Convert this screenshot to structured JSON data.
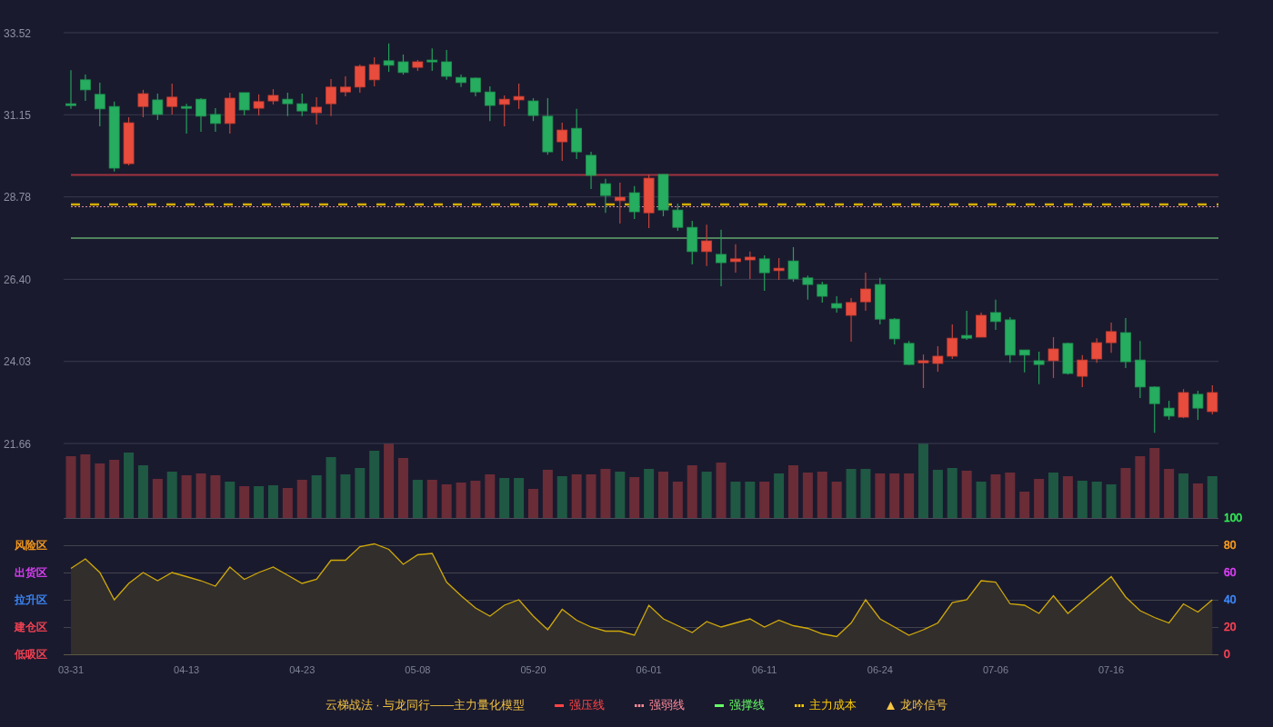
{
  "price_chart": {
    "chart_data": {
      "type": "candlestick",
      "categories": [
        null,
        null,
        null,
        null,
        null,
        null,
        null,
        null,
        null,
        null,
        null,
        null,
        null,
        null,
        null,
        null,
        null,
        null,
        null,
        null,
        null,
        null,
        null,
        null,
        null,
        null,
        null,
        null,
        null,
        null,
        null,
        null,
        null,
        null,
        null,
        null,
        null,
        null,
        null,
        null,
        null,
        null,
        null,
        null,
        null,
        null,
        null,
        null,
        null,
        null,
        null,
        null,
        null,
        null,
        null,
        null,
        null,
        null,
        null,
        null,
        null,
        null,
        null,
        null,
        null,
        null,
        null,
        null,
        null,
        null,
        null,
        null,
        null,
        null,
        null,
        null,
        null,
        null,
        null,
        null
      ],
      "ylim": [
        21.66,
        33.52
      ],
      "yticks": [
        {
          "value": 33.52,
          "label": "33.52"
        },
        {
          "value": 31.15,
          "label": "31.15"
        },
        {
          "value": 28.78,
          "label": "28.78"
        },
        {
          "value": 26.4,
          "label": "26.40"
        },
        {
          "value": 24.03,
          "label": "24.03"
        },
        {
          "value": 21.66,
          "label": "21.66"
        }
      ],
      "grid": true,
      "ohlc": [
        [
          31.47,
          32.44,
          31.32,
          31.42
        ],
        [
          32.16,
          32.31,
          31.55,
          31.87
        ],
        [
          31.74,
          32.08,
          30.82,
          31.32
        ],
        [
          31.39,
          31.53,
          29.51,
          29.61
        ],
        [
          29.74,
          31.08,
          29.69,
          30.92
        ],
        [
          31.39,
          31.87,
          31.08,
          31.76
        ],
        [
          31.58,
          31.76,
          31.0,
          31.16
        ],
        [
          31.39,
          32.05,
          31.16,
          31.66
        ],
        [
          31.39,
          31.47,
          30.61,
          31.34
        ],
        [
          31.6,
          31.63,
          30.66,
          31.11
        ],
        [
          31.16,
          31.34,
          30.66,
          30.9
        ],
        [
          30.9,
          31.79,
          30.61,
          31.63
        ],
        [
          31.79,
          31.79,
          31.13,
          31.29
        ],
        [
          31.34,
          31.74,
          31.13,
          31.53
        ],
        [
          31.55,
          31.89,
          31.45,
          31.71
        ],
        [
          31.6,
          31.79,
          31.11,
          31.47
        ],
        [
          31.47,
          31.76,
          31.11,
          31.26
        ],
        [
          31.21,
          31.66,
          30.87,
          31.37
        ],
        [
          31.47,
          32.18,
          31.11,
          31.95
        ],
        [
          31.81,
          32.26,
          31.68,
          31.95
        ],
        [
          31.95,
          32.6,
          31.79,
          32.55
        ],
        [
          32.16,
          32.81,
          31.97,
          32.6
        ],
        [
          32.71,
          33.21,
          32.39,
          32.58
        ],
        [
          32.68,
          32.89,
          32.31,
          32.37
        ],
        [
          32.52,
          32.73,
          32.42,
          32.68
        ],
        [
          32.73,
          33.07,
          32.42,
          32.68
        ],
        [
          32.68,
          33.02,
          32.16,
          32.26
        ],
        [
          32.23,
          32.31,
          31.95,
          32.08
        ],
        [
          32.21,
          32.23,
          31.68,
          31.81
        ],
        [
          31.81,
          31.97,
          30.97,
          31.42
        ],
        [
          31.45,
          31.71,
          30.82,
          31.6
        ],
        [
          31.58,
          32.05,
          31.32,
          31.68
        ],
        [
          31.55,
          31.63,
          30.97,
          31.13
        ],
        [
          31.11,
          31.63,
          30.0,
          30.08
        ],
        [
          30.37,
          30.92,
          29.82,
          30.71
        ],
        [
          30.76,
          31.32,
          29.87,
          30.08
        ],
        [
          29.98,
          30.08,
          29.01,
          29.4
        ],
        [
          29.16,
          29.3,
          28.32,
          28.82
        ],
        [
          28.67,
          29.19,
          28.01,
          28.77
        ],
        [
          28.9,
          29.09,
          28.14,
          28.35
        ],
        [
          28.32,
          29.43,
          27.88,
          29.32
        ],
        [
          29.43,
          29.43,
          28.22,
          28.4
        ],
        [
          28.4,
          28.59,
          27.8,
          27.9
        ],
        [
          27.9,
          28.09,
          26.83,
          27.2
        ],
        [
          27.2,
          27.98,
          26.78,
          27.51
        ],
        [
          27.12,
          27.83,
          26.2,
          26.88
        ],
        [
          26.91,
          27.41,
          26.59,
          26.99
        ],
        [
          26.96,
          27.2,
          26.41,
          27.04
        ],
        [
          26.99,
          27.09,
          26.07,
          26.59
        ],
        [
          26.65,
          27.01,
          26.38,
          26.72
        ],
        [
          26.93,
          27.33,
          26.33,
          26.41
        ],
        [
          26.44,
          26.51,
          25.81,
          26.25
        ],
        [
          26.25,
          26.33,
          25.73,
          25.91
        ],
        [
          25.7,
          25.91,
          25.44,
          25.57
        ],
        [
          25.36,
          25.86,
          24.6,
          25.73
        ],
        [
          25.75,
          26.59,
          25.49,
          26.12
        ],
        [
          26.25,
          26.44,
          25.1,
          25.25
        ],
        [
          25.25,
          25.28,
          24.52,
          24.68
        ],
        [
          24.55,
          24.62,
          23.92,
          23.94
        ],
        [
          23.99,
          24.23,
          23.26,
          24.05
        ],
        [
          23.97,
          24.47,
          23.73,
          24.18
        ],
        [
          24.18,
          25.1,
          24.1,
          24.7
        ],
        [
          24.78,
          25.49,
          24.65,
          24.7
        ],
        [
          24.73,
          25.44,
          24.73,
          25.36
        ],
        [
          25.44,
          25.81,
          24.94,
          25.18
        ],
        [
          25.23,
          25.31,
          23.99,
          24.21
        ],
        [
          24.36,
          24.36,
          23.71,
          24.21
        ],
        [
          24.05,
          24.31,
          23.37,
          23.94
        ],
        [
          24.05,
          24.73,
          23.55,
          24.39
        ],
        [
          24.55,
          24.57,
          23.65,
          23.68
        ],
        [
          23.6,
          24.21,
          23.29,
          24.07
        ],
        [
          24.1,
          24.7,
          23.99,
          24.57
        ],
        [
          24.57,
          25.15,
          24.28,
          24.89
        ],
        [
          24.86,
          25.28,
          23.84,
          24.02
        ],
        [
          24.07,
          24.62,
          22.97,
          23.29
        ],
        [
          23.29,
          23.31,
          21.97,
          22.81
        ],
        [
          22.68,
          22.89,
          22.34,
          22.45
        ],
        [
          22.42,
          23.23,
          22.39,
          23.13
        ],
        [
          23.08,
          23.18,
          22.34,
          22.68
        ],
        [
          22.58,
          23.34,
          22.5,
          23.13
        ]
      ]
    }
  },
  "indicator": {
    "zones": [
      {
        "label": "风险区",
        "color": "#ff9f1a"
      },
      {
        "label": "出货区",
        "color": "#e040fb"
      },
      {
        "label": "拉升区",
        "color": "#3d8bfd"
      },
      {
        "label": "建仓区",
        "color": "#ff4455"
      },
      {
        "label": "低吸区",
        "color": "#ff4455"
      }
    ],
    "axis_labels": [
      {
        "label": "100",
        "color": "#33ee55"
      },
      {
        "label": "80",
        "color": "#ff9f1a"
      },
      {
        "label": "60",
        "color": "#e040fb"
      },
      {
        "label": "40",
        "color": "#3d8bfd"
      },
      {
        "label": "20",
        "color": "#ff4455"
      },
      {
        "label": "0",
        "color": "#ff4455"
      }
    ],
    "chart_data": {
      "type": "area",
      "categories": [
        "03-31",
        null,
        null,
        null,
        null,
        null,
        null,
        null,
        "04-13",
        null,
        null,
        null,
        null,
        null,
        null,
        null,
        "04-23",
        null,
        null,
        null,
        null,
        null,
        null,
        null,
        "05-08",
        null,
        null,
        null,
        null,
        null,
        null,
        null,
        "05-20",
        null,
        null,
        null,
        null,
        null,
        null,
        null,
        "06-01",
        null,
        null,
        null,
        null,
        null,
        null,
        null,
        "06-11",
        null,
        null,
        null,
        null,
        null,
        null,
        null,
        "06-24",
        null,
        null,
        null,
        null,
        null,
        null,
        null,
        "07-06",
        null,
        null,
        null,
        null,
        null,
        null,
        null,
        "07-16",
        null,
        null,
        null,
        null,
        null,
        null,
        null
      ],
      "ylim": [
        0,
        100
      ],
      "grid": true,
      "yticks": [
        100,
        80,
        60,
        40,
        20,
        0
      ],
      "values": [
        63,
        70,
        60,
        40,
        52,
        60,
        54,
        60,
        57,
        54,
        50,
        64,
        55,
        60,
        64,
        58,
        52,
        55,
        69,
        69,
        79,
        81,
        77,
        66,
        73,
        74,
        53,
        43,
        34,
        28,
        36,
        40,
        28,
        18,
        33,
        25,
        20,
        17,
        17,
        14,
        36,
        26,
        21,
        16,
        24,
        20,
        23,
        26,
        20,
        25,
        21,
        19,
        15,
        13,
        23,
        40,
        26,
        20,
        14,
        18,
        23,
        38,
        40,
        54,
        53,
        37,
        36,
        30,
        43,
        30,
        39,
        48,
        57,
        42,
        32,
        27,
        23,
        37,
        31,
        40
      ]
    }
  },
  "legend": {
    "title": "云梯战法 · 与龙同行——主力量化模型",
    "items": [
      {
        "label": "强压线",
        "kind": "solid",
        "color": "#ff4444"
      },
      {
        "label": "强弱线",
        "kind": "dashed",
        "color": "#ff8a99"
      },
      {
        "label": "强撑线",
        "kind": "solid",
        "color": "#66ff66"
      },
      {
        "label": "主力成本",
        "kind": "dashed",
        "color": "#ffcc00"
      },
      {
        "label": "龙吟信号",
        "kind": "triangle",
        "color": "#f5c542"
      }
    ]
  }
}
